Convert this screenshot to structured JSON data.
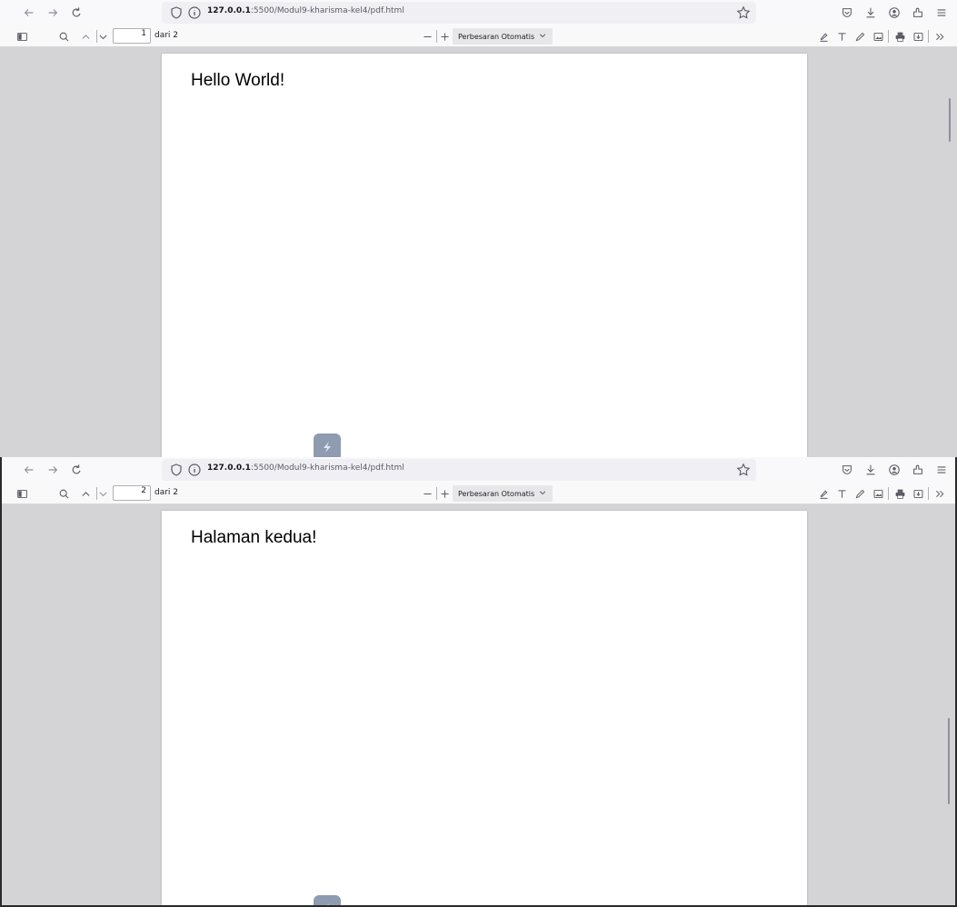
{
  "screens": [
    {
      "url_host": "127.0.0.1",
      "url_path": ":5500/Modul9-kharisma-kel4/pdf.html",
      "page_number": "1",
      "page_of": "dari 2",
      "zoom_label": "Perbesaran Otomatis",
      "page_text": "Hello World!"
    },
    {
      "url_host": "127.0.0.1",
      "url_path": ":5500/Modul9-kharisma-kel4/pdf.html",
      "page_number": "2",
      "page_of": "dari 2",
      "zoom_label": "Perbesaran Otomatis",
      "page_text": "Halaman kedua!"
    }
  ],
  "colors": {
    "viewer_bg": "#d4d4d7",
    "toolbar_bg": "#f9f9fa",
    "urlbar_bg": "#f0f0f4",
    "icon": "#5b5b66"
  }
}
